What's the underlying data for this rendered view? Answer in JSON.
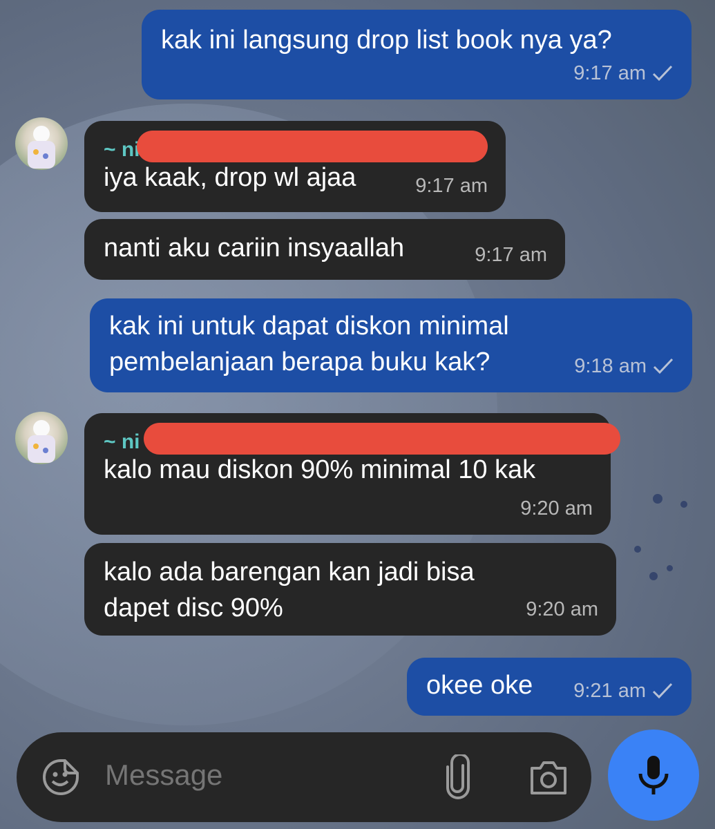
{
  "messages": [
    {
      "id": "m1",
      "direction": "outgoing",
      "text": "kak ini langsung drop list book nya ya?",
      "time": "9:17 am",
      "status": "sent"
    },
    {
      "id": "m2",
      "direction": "incoming",
      "sender": "~ ni",
      "text": "iya kaak, drop wl ajaa",
      "time": "9:17 am"
    },
    {
      "id": "m3",
      "direction": "incoming",
      "text": "nanti aku cariin insyaallah",
      "time": "9:17 am"
    },
    {
      "id": "m4",
      "direction": "outgoing",
      "text": "kak ini untuk dapat diskon minimal\npembelanjaan berapa buku kak?",
      "time": "9:18 am",
      "status": "sent"
    },
    {
      "id": "m5",
      "direction": "incoming",
      "sender": "~ ni",
      "text": "kalo mau diskon 90% minimal 10 kak",
      "time": "9:20 am"
    },
    {
      "id": "m6",
      "direction": "incoming",
      "text": "kalo ada barengan kan jadi bisa\ndapet disc 90%",
      "time": "9:20 am"
    },
    {
      "id": "m7",
      "direction": "outgoing",
      "text": "okee oke",
      "time": "9:21 am",
      "status": "sent"
    }
  ],
  "composer": {
    "placeholder": "Message",
    "icons": [
      "sticker-icon",
      "attachment-clip-icon",
      "camera-icon",
      "microphone-icon"
    ]
  },
  "colors": {
    "outgoing_bubble": "#1d4ea5",
    "incoming_bubble": "#262626",
    "sender_name": "#5ec7c3",
    "redaction": "#e84c3d",
    "mic_button": "#3a82f6"
  }
}
